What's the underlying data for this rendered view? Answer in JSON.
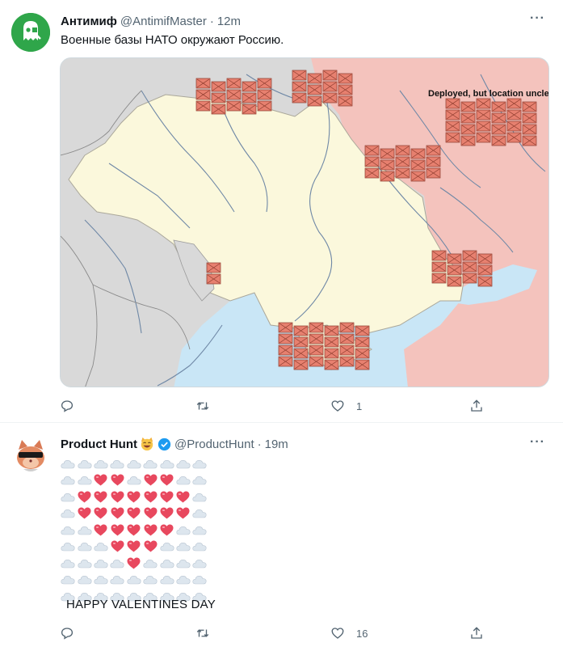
{
  "tweets": [
    {
      "name": "Антимиф",
      "handle": "@AntimifMaster",
      "time": "12m",
      "text": "Военные базы НАТО окружают Россию.",
      "avatar_icon": "ghost-logo-icon",
      "avatar_color": "#2fa64a",
      "media": {
        "label": "Deployed, but location unclear:",
        "colors": {
          "ukraine": "#fbf8dc",
          "russia": "#f4c3bd",
          "others": "#d9d9d9",
          "sea": "#c9e6f6",
          "base_marker": "#e7806f"
        }
      },
      "stats": {
        "replies": "",
        "retweets": "",
        "likes": "1"
      }
    },
    {
      "name": "Product Hunt",
      "handle": "@ProductHunt",
      "time": "19m",
      "avatar_icon": "product-hunt-kitty-icon",
      "caption": "HAPPY VALENTINES DAY",
      "emoji_rows": [
        "CCCCCCCCC",
        "CCHHCHHCC",
        "CHHHHHHHC",
        "CHHHHHHHC",
        "CCHHHHHCC",
        "CCCHHHCCC",
        "CCCCHCCCC",
        "CCCCCCCCC",
        "CCCCCCCCC"
      ],
      "stats": {
        "replies": "",
        "retweets": "",
        "likes": "16"
      }
    }
  ]
}
